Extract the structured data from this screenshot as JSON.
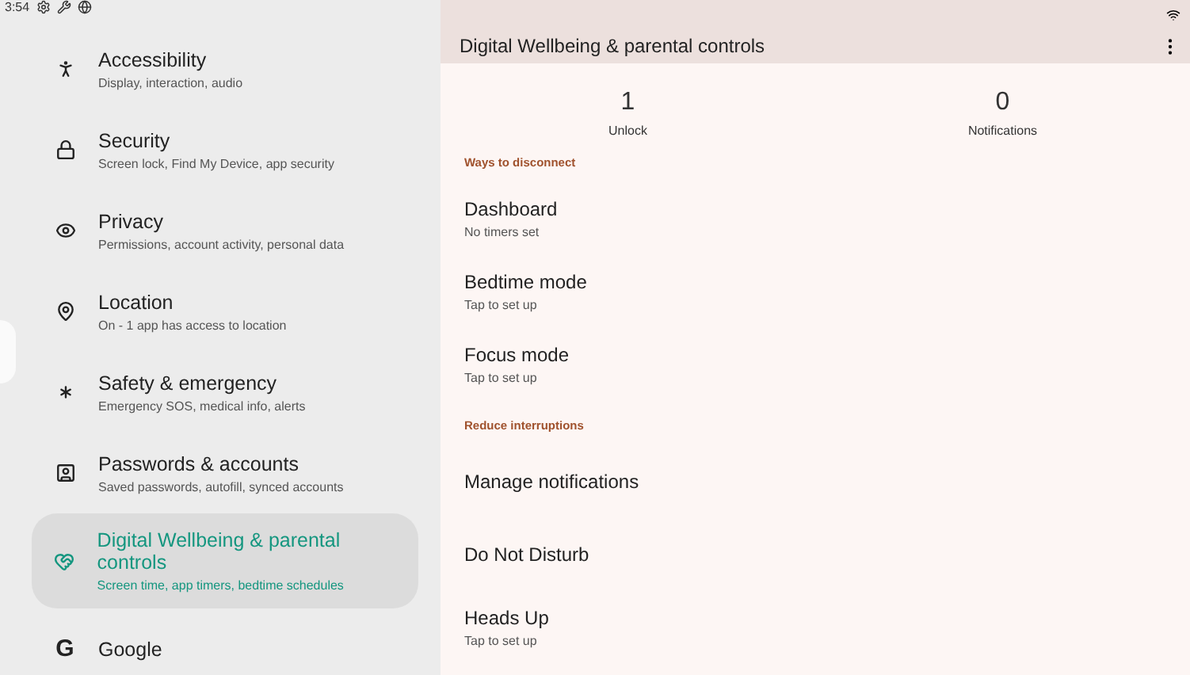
{
  "status_bar": {
    "time": "3:54"
  },
  "sidebar": {
    "items": [
      {
        "title": "Accessibility",
        "subtitle": "Display, interaction, audio",
        "selected": false
      },
      {
        "title": "Security",
        "subtitle": "Screen lock, Find My Device, app security",
        "selected": false
      },
      {
        "title": "Privacy",
        "subtitle": "Permissions, account activity, personal data",
        "selected": false
      },
      {
        "title": "Location",
        "subtitle": "On - 1 app has access to location",
        "selected": false
      },
      {
        "title": "Safety & emergency",
        "subtitle": "Emergency SOS, medical info, alerts",
        "selected": false
      },
      {
        "title": "Passwords & accounts",
        "subtitle": "Saved passwords, autofill, synced accounts",
        "selected": false
      },
      {
        "title": "Digital Wellbeing & parental controls",
        "subtitle": "Screen time, app timers, bedtime schedules",
        "selected": true
      },
      {
        "icon_text": "G",
        "title": "Google",
        "selected": false
      }
    ]
  },
  "detail": {
    "title": "Digital Wellbeing & parental controls",
    "stats": [
      {
        "value": "1",
        "label": "Unlock"
      },
      {
        "value": "0",
        "label": "Notifications"
      }
    ],
    "sections": [
      {
        "header": "Ways to disconnect",
        "rows": [
          {
            "title": "Dashboard",
            "subtitle": "No timers set"
          },
          {
            "title": "Bedtime mode",
            "subtitle": "Tap to set up"
          },
          {
            "title": "Focus mode",
            "subtitle": "Tap to set up"
          }
        ]
      },
      {
        "header": "Reduce interruptions",
        "rows": [
          {
            "title": "Manage notifications"
          },
          {
            "title": "Do Not Disturb"
          },
          {
            "title": "Heads Up",
            "subtitle": "Tap to set up"
          }
        ]
      }
    ]
  }
}
